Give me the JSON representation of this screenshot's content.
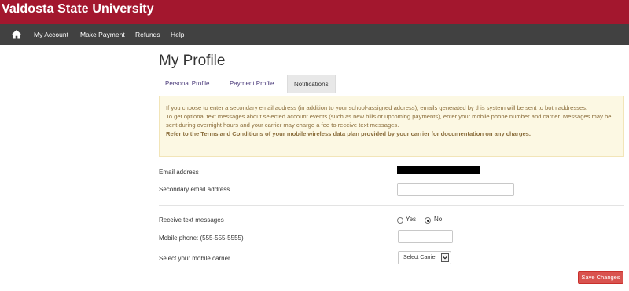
{
  "header": {
    "brand": "Valdosta State University"
  },
  "nav": {
    "items": [
      "My Account",
      "Make Payment",
      "Refunds",
      "Help"
    ]
  },
  "page": {
    "title": "My Profile"
  },
  "tabs": [
    {
      "label": "Personal Profile"
    },
    {
      "label": "Payment Profile"
    },
    {
      "label": "Notifications"
    }
  ],
  "alert": {
    "line1": "If you choose to enter a secondary email address (in addition to your school-assigned address), emails generated by this system will be sent to both addresses.",
    "line2": "To get optional text messages about selected account events (such as new bills or upcoming payments), enter your mobile phone number and carrier. Messages may be sent during overnight hours and your carrier may charge a fee to receive text messages.",
    "line3": "Refer to the Terms and Conditions of your mobile wireless data plan provided by your carrier for documentation on any charges."
  },
  "form": {
    "email_label": "Email address",
    "secondary_email_label": "Secondary email address",
    "secondary_email_value": "",
    "receive_text_label": "Receive text messages",
    "yes_label": "Yes",
    "no_label": "No",
    "selected_option": "No",
    "mobile_label": "Mobile phone: (555-555-5555)",
    "mobile_value": "",
    "carrier_label": "Select your mobile carrier",
    "carrier_selected": "Select Carrier"
  },
  "actions": {
    "save_label": "Save Changes"
  },
  "colors": {
    "brand": "#a3172e",
    "nav": "#414141",
    "alert_bg": "#fcf8e3",
    "save": "#d9534f"
  }
}
